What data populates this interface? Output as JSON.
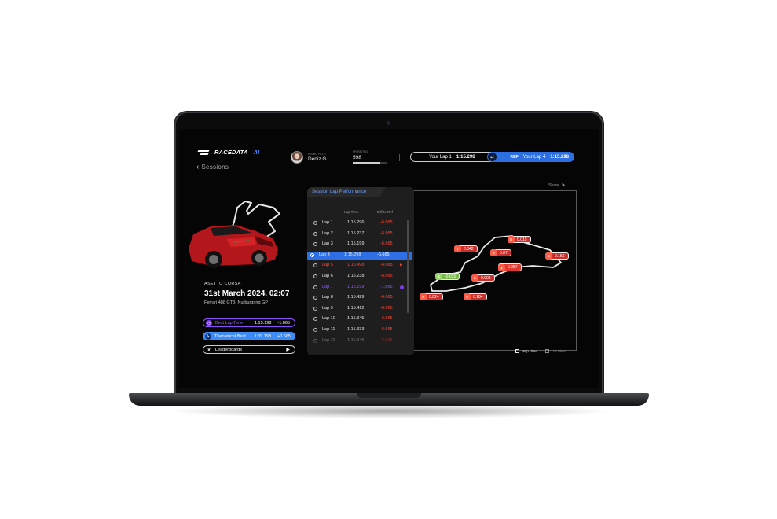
{
  "header": {
    "logo_text": "RACEDATA",
    "logo_ai": "AI",
    "back_label": "Sessions",
    "pilot_caption": "RISING PILOT",
    "pilot_name": "Deniz G.",
    "rating_caption": "MY RATING",
    "rating_value": "598",
    "rating_progress": 0.8,
    "compare": {
      "left_label": "Your Lap 1",
      "left_time": "1:15.296",
      "ref_tag": "REF",
      "right_label": "Your Lap 4",
      "right_time": "1:15.298"
    }
  },
  "session": {
    "game": "ASETTO CORSA",
    "date": "31st March 2024, 02:07",
    "car": "Ferrari 488 GT3- Nurburgring GP",
    "best_lap": {
      "label": "Best Lap Time",
      "time": "1:15.198",
      "diff": "-1.665"
    },
    "theoretical": {
      "label": "Theoretical Best",
      "time": "1:09.198",
      "diff": "+0.665"
    },
    "leaderboards_label": "Leaderboards"
  },
  "laps_panel": {
    "title": "Session Lap Performance",
    "col_time": "Lap Time",
    "col_diff": "Diff to Ref",
    "rows": [
      {
        "lap": "Lap 1",
        "time": "1:15.296",
        "diff": "-6.665",
        "state": "normal"
      },
      {
        "lap": "Lap 2",
        "time": "1:15.237",
        "diff": "-6.665",
        "state": "normal"
      },
      {
        "lap": "Lap 3",
        "time": "1:15.199",
        "diff": "-6.665",
        "state": "normal"
      },
      {
        "lap": "Lap 4",
        "time": "1:15.298",
        "diff": "-6.665",
        "state": "selected"
      },
      {
        "lap": "Lap 5",
        "time": "1:15.498",
        "diff": "-6.665",
        "state": "invalid"
      },
      {
        "lap": "Lap 6",
        "time": "1:15.238",
        "diff": "-6.665",
        "state": "normal"
      },
      {
        "lap": "Lap 7",
        "time": "1:15.199",
        "diff": "-1.665",
        "state": "best"
      },
      {
        "lap": "Lap 8",
        "time": "1:15.429",
        "diff": "-6.665",
        "state": "normal"
      },
      {
        "lap": "Lap 9",
        "time": "1:15.412",
        "diff": "-6.665",
        "state": "normal"
      },
      {
        "lap": "Lap 10",
        "time": "1:15.345",
        "diff": "-6.665",
        "state": "normal"
      },
      {
        "lap": "Lap 11",
        "time": "1:15.333",
        "diff": "-6.665",
        "state": "normal"
      },
      {
        "lap": "Lap 11",
        "time": "1:15.346",
        "diff": "-6.665",
        "state": "normal"
      }
    ]
  },
  "map": {
    "share_label": "Share",
    "map_view_label": "Map View",
    "list_view_label": "List View",
    "segments": [
      {
        "num": "8",
        "val": "0.015",
        "color": "#c9302c"
      },
      {
        "num": "7",
        "val": "0.042",
        "color": "#c9302c"
      },
      {
        "num": "6",
        "val": "0.07",
        "color": "#c9302c"
      },
      {
        "num": "9",
        "val": "0.156",
        "color": "#c9302c"
      },
      {
        "num": "1",
        "val": "0.257",
        "color": "#e0392f"
      },
      {
        "num": "2",
        "val": "-0.015",
        "color": "#7bb84b"
      },
      {
        "num": "3",
        "val": "0.008",
        "color": "#c9302c"
      },
      {
        "num": "5",
        "val": "0.024",
        "color": "#c9302c"
      },
      {
        "num": "4",
        "val": "0.184",
        "color": "#c9302c"
      }
    ]
  }
}
